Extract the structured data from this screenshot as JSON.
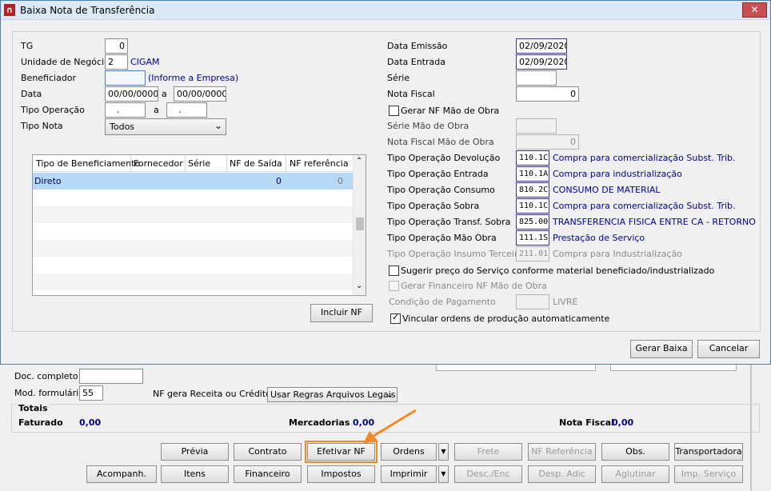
{
  "window": {
    "title": "Baixa Nota de Transferência"
  },
  "left": {
    "tg_label": "TG",
    "tg_value": "0",
    "unidade_label": "Unidade de Negócio",
    "unidade_value": "2",
    "unidade_name": "CIGAM",
    "benef_label": "Beneficiador",
    "benef_value": "",
    "benef_hint": "(Informe a Empresa)",
    "data_label": "Data",
    "data_from": "00/00/0000",
    "data_sep": "a",
    "data_to": "00/00/0000",
    "tipoop_label": "Tipo Operação",
    "tipoop_from": ".",
    "tipoop_sep": "a",
    "tipoop_to": ".",
    "tiponota_label": "Tipo Nota",
    "tiponota_value": "Todos"
  },
  "grid": {
    "columns": [
      "Tipo de Beneficiamento",
      "Fornecedor",
      "Série",
      "NF de Saída",
      "NF referência"
    ],
    "rows": [
      {
        "tipo": "Direto",
        "fornecedor": "",
        "serie": "",
        "nf_saida": "0",
        "nf_ref": "0"
      }
    ],
    "incluir_label": "Incluir NF"
  },
  "right": {
    "data_emissao_label": "Data Emissão",
    "data_emissao": "02/09/2020",
    "data_entrada_label": "Data Entrada",
    "data_entrada": "02/09/2020",
    "serie_label": "Série",
    "serie": "",
    "nota_fiscal_label": "Nota Fiscal",
    "nota_fiscal": "0",
    "gerar_nf_label": "Gerar NF Mão de Obra",
    "serie_mo_label": "Série Mão de Obra",
    "serie_mo": "",
    "nf_mo_label": "Nota Fiscal Mão de Obra",
    "nf_mo": "0",
    "ops": [
      {
        "label": "Tipo Operação Devolução",
        "code": "110.1C",
        "desc": "Compra para comercialização Subst. Trib."
      },
      {
        "label": "Tipo Operação Entrada",
        "code": "110.1A",
        "desc": "Compra para industrialização"
      },
      {
        "label": "Tipo Operação Consumo",
        "code": "810.2C",
        "desc": "CONSUMO DE MATERIAL"
      },
      {
        "label": "Tipo Operação Sobra",
        "code": "110.1C",
        "desc": "Compra para comercialização Subst. Trib."
      },
      {
        "label": "Tipo Operação Transf. Sobra",
        "code": "825.00",
        "desc": "TRANSFERENCIA FISICA ENTRE CA - RETORNO"
      },
      {
        "label": "Tipo Operação Mão Obra",
        "code": "111.1S",
        "desc": "Prestação de Serviço"
      },
      {
        "label": "Tipo Operação Insumo Terceiro",
        "code": "211.01",
        "desc": "Compra para Industrialização"
      }
    ],
    "sugerir_label": "Sugerir preço do Serviço conforme material beneficiado/industrializado",
    "gerar_fin_label": "Gerar Financeiro NF Mão de Obra",
    "cond_label": "Condição de Pagamento",
    "cond_code": "",
    "cond_desc": "LIVRE",
    "vincular_label": "Vincular ordens de produção automaticamente"
  },
  "dialog_buttons": {
    "gerar": "Gerar Baixa",
    "cancelar": "Cancelar"
  },
  "bg": {
    "doc_label": "Doc. completo",
    "doc_value": "",
    "mod_label": "Mod. formulário",
    "mod_value": "55",
    "nf_receita_label": "NF gera Receita ou Crédito",
    "nf_receita_value": "Usar Regras Arquivos Legais",
    "totais_label": "Totais",
    "faturado_label": "Faturado",
    "faturado_value": "0,00",
    "mercadorias_label": "Mercadorias",
    "mercadorias_value": "0,00",
    "notafiscal_label": "Nota Fiscal",
    "notafiscal_value": "0,00",
    "row1": [
      "Prévia",
      "Contrato",
      "Efetivar NF",
      "Ordens",
      "Frete",
      "NF Referência",
      "Obs.",
      "Transportadora"
    ],
    "row2": [
      "Acompanh.",
      "Itens",
      "Financeiro",
      "Impostos",
      "Imprimir",
      "Desc./Enc",
      "Desp. Adic",
      "Aglutinar",
      "Imp. Serviço"
    ]
  },
  "colors": {
    "accent": "#f08a24",
    "blue_text": "#000099",
    "selected_row": "#b8d9f5"
  }
}
